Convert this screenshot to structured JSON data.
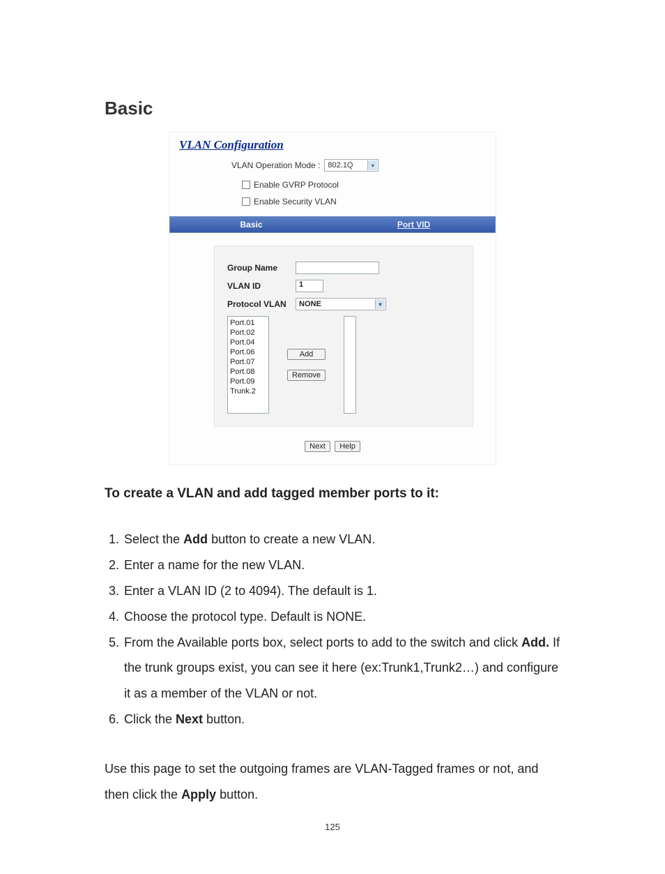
{
  "heading": "Basic",
  "screenshot": {
    "title": "VLAN Configuration",
    "mode_label": "VLAN Operation Mode :",
    "mode_value": "802.1Q",
    "enable_gvrp": "Enable GVRP Protocol",
    "enable_security": "Enable Security VLAN",
    "tabs": {
      "basic": "Basic",
      "port_vid": "Port VID"
    },
    "fields": {
      "group_name_label": "Group Name",
      "group_name_value": "",
      "vlan_id_label": "VLAN ID",
      "vlan_id_value": "1",
      "protocol_label": "Protocol VLAN",
      "protocol_value": "NONE"
    },
    "available_ports": [
      "Port.01",
      "Port.02",
      "Port.04",
      "Port.06",
      "Port.07",
      "Port.08",
      "Port.09",
      "Trunk.2"
    ],
    "buttons": {
      "add": "Add",
      "remove": "Remove",
      "next": "Next",
      "help": "Help"
    }
  },
  "subheading": "To create a VLAN and add tagged member ports to it:",
  "steps": {
    "s1_a": "Select the ",
    "s1_b": "Add",
    "s1_c": " button to create a new VLAN.",
    "s2": "Enter a name for the new VLAN.",
    "s3": "Enter a VLAN ID (2 to 4094). The default is 1.",
    "s4": "Choose the protocol type. Default is NONE.",
    "s5_a": "From the Available ports box, select ports to add to the switch and click ",
    "s5_b": "Add.",
    "s5_c": " If the trunk groups exist, you can see it here (ex:Trunk1,Trunk2…) and configure it as a member of the VLAN or not.",
    "s6_a": "Click the ",
    "s6_b": "Next",
    "s6_c": " button."
  },
  "paragraph": {
    "p1": "Use this page to set the outgoing frames are VLAN-Tagged frames or not, and then click the ",
    "p2": "Apply",
    "p3": " button."
  },
  "page_number": "125"
}
